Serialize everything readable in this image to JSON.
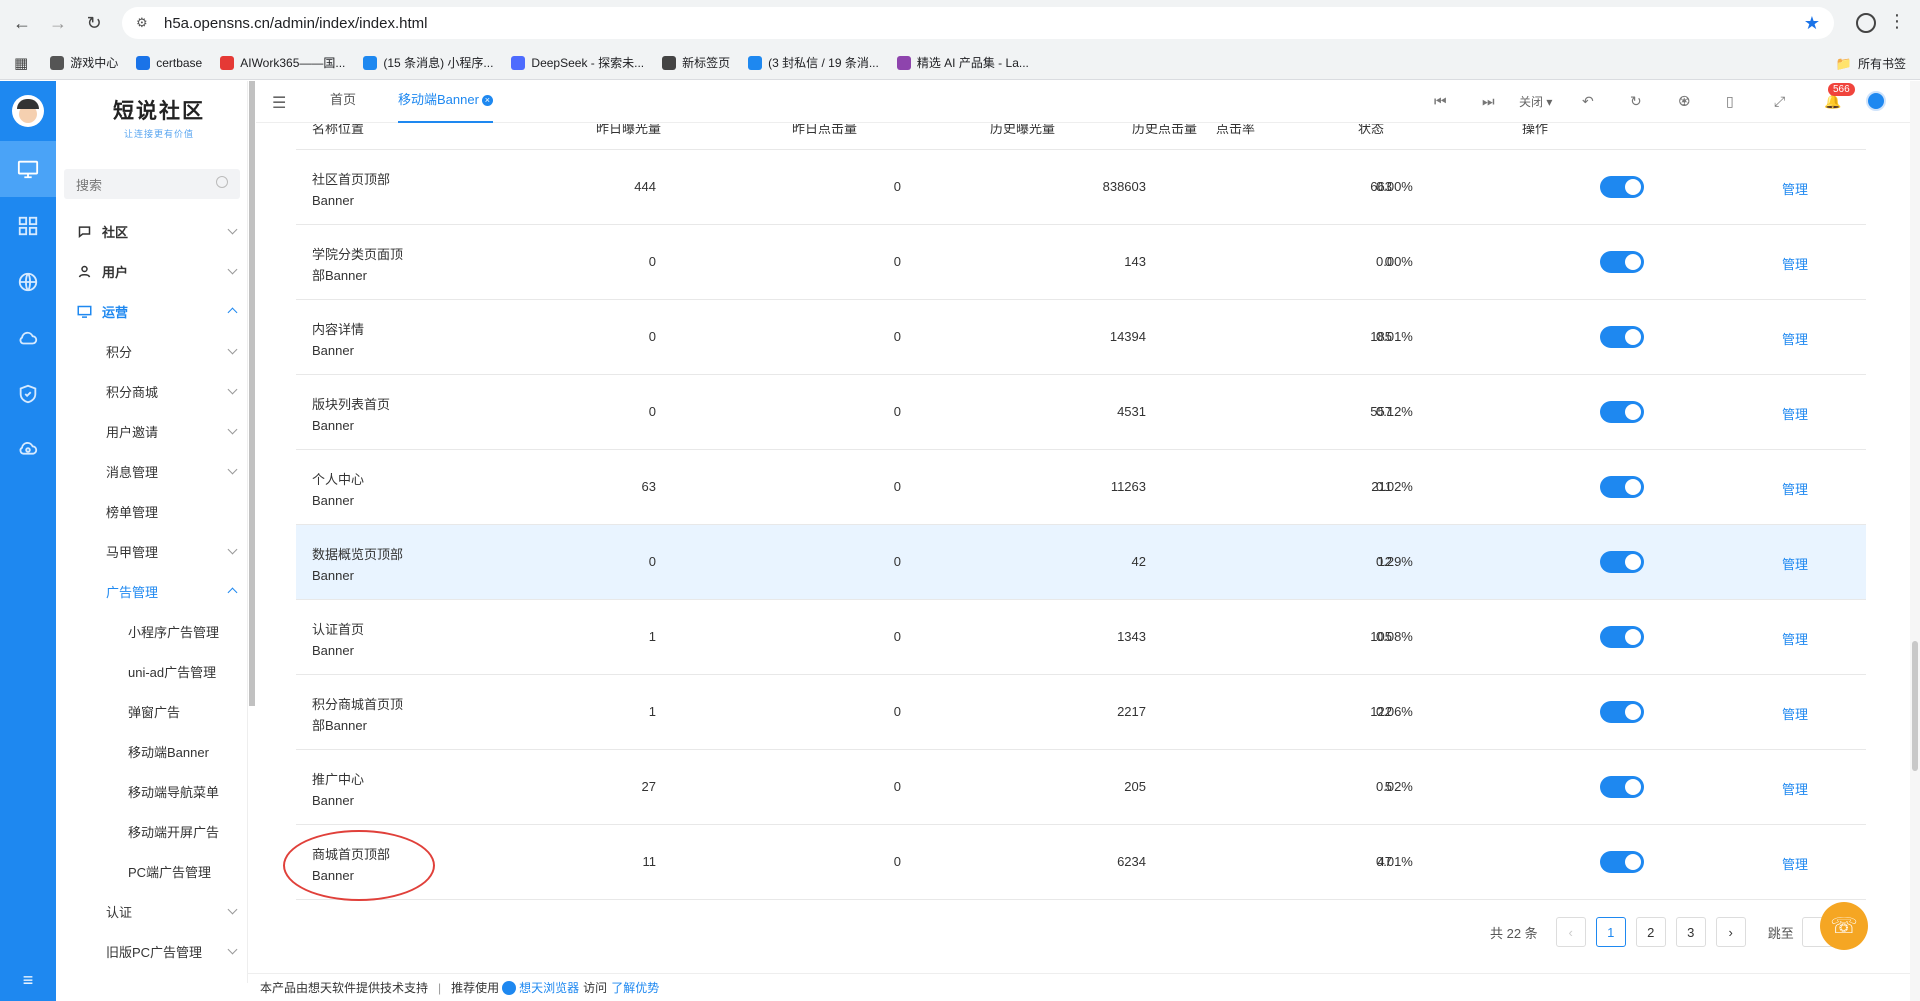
{
  "browser": {
    "url": "h5a.opensns.cn/admin/index/index.html",
    "bookmarks": [
      {
        "label": "游戏中心",
        "icon": "globe-icon",
        "color": "#555555"
      },
      {
        "label": "certbase",
        "icon": "c-icon",
        "color": "#1a73e8"
      },
      {
        "label": "AIWork365——国...",
        "icon": "aiwork-icon",
        "color": "#e53935"
      },
      {
        "label": "(15 条消息) 小程序...",
        "icon": "zhihu-icon",
        "color": "#1e88f0"
      },
      {
        "label": "DeepSeek - 探索未...",
        "icon": "deepseek-icon",
        "color": "#4d6bfe"
      },
      {
        "label": "新标签页",
        "icon": "chrome-icon",
        "color": "#444444"
      },
      {
        "label": "(3 封私信 / 19 条消...",
        "icon": "zhihu-icon",
        "color": "#1e88f0"
      },
      {
        "label": "精选 AI 产品集 - La...",
        "icon": "ai-icon",
        "color": "#8e44ad"
      }
    ],
    "all_bookmarks": "所有书签"
  },
  "sidebar": {
    "logo_main": "短说社区",
    "logo_sub": "让连接更有价值",
    "search_placeholder": "搜索",
    "menu": [
      {
        "label": "社区",
        "level": "top",
        "icon": "chat-icon"
      },
      {
        "label": "用户",
        "level": "top",
        "icon": "user-icon"
      },
      {
        "label": "运营",
        "level": "top",
        "icon": "monitor-icon",
        "active": true
      },
      {
        "label": "积分",
        "level": "sub"
      },
      {
        "label": "积分商城",
        "level": "sub"
      },
      {
        "label": "用户邀请",
        "level": "sub"
      },
      {
        "label": "消息管理",
        "level": "sub"
      },
      {
        "label": "榜单管理",
        "level": "sub"
      },
      {
        "label": "马甲管理",
        "level": "sub"
      },
      {
        "label": "广告管理",
        "level": "sub",
        "active": true
      },
      {
        "label": "小程序广告管理",
        "level": "leaf"
      },
      {
        "label": "uni-ad广告管理",
        "level": "leaf"
      },
      {
        "label": "弹窗广告",
        "level": "leaf"
      },
      {
        "label": "移动端Banner",
        "level": "leaf"
      },
      {
        "label": "移动端导航菜单",
        "level": "leaf"
      },
      {
        "label": "移动端开屏广告",
        "level": "leaf"
      },
      {
        "label": "PC端广告管理",
        "level": "leaf"
      },
      {
        "label": "认证",
        "level": "sub"
      },
      {
        "label": "旧版PC广告管理",
        "level": "sub"
      }
    ]
  },
  "tabs": {
    "home": "首页",
    "active": "移动端Banner",
    "close_label": "关闭",
    "notification_count": "566"
  },
  "table": {
    "headers": [
      "名称位置",
      "昨日曝光量",
      "昨日点击量",
      "历史曝光量",
      "历史点击量",
      "点击率",
      "状态",
      "操作"
    ],
    "rows": [
      {
        "name1": "社区首页顶部",
        "name2": "Banner",
        "y_exp": "444",
        "y_click": "0",
        "h_exp": "838603",
        "h_click": "663",
        "rate": "0.00%",
        "action": "管理"
      },
      {
        "name1": "学院分类页面顶",
        "name2": "部Banner",
        "y_exp": "0",
        "y_click": "0",
        "h_exp": "143",
        "h_click": "0",
        "rate": "0.00%",
        "action": "管理"
      },
      {
        "name1": "内容详情",
        "name2": "Banner",
        "y_exp": "0",
        "y_click": "0",
        "h_exp": "14394",
        "h_click": "185",
        "rate": "0.01%",
        "action": "管理"
      },
      {
        "name1": "版块列表首页",
        "name2": "Banner",
        "y_exp": "0",
        "y_click": "0",
        "h_exp": "4531",
        "h_click": "557",
        "rate": "0.12%",
        "action": "管理"
      },
      {
        "name1": "个人中心",
        "name2": "Banner",
        "y_exp": "63",
        "y_click": "0",
        "h_exp": "11263",
        "h_click": "211",
        "rate": "0.02%",
        "action": "管理"
      },
      {
        "name1": "数据概览页顶部",
        "name2": "Banner",
        "y_exp": "0",
        "y_click": "0",
        "h_exp": "42",
        "h_click": "12",
        "rate": "0.29%",
        "action": "管理"
      },
      {
        "name1": "认证首页",
        "name2": "Banner",
        "y_exp": "1",
        "y_click": "0",
        "h_exp": "1343",
        "h_click": "105",
        "rate": "0.08%",
        "action": "管理"
      },
      {
        "name1": "积分商城首页顶",
        "name2": "部Banner",
        "y_exp": "1",
        "y_click": "0",
        "h_exp": "2217",
        "h_click": "122",
        "rate": "0.06%",
        "action": "管理"
      },
      {
        "name1": "推广中心",
        "name2": "Banner",
        "y_exp": "27",
        "y_click": "0",
        "h_exp": "205",
        "h_click": "5",
        "rate": "0.02%",
        "action": "管理"
      },
      {
        "name1": "商城首页顶部",
        "name2": "Banner",
        "y_exp": "11",
        "y_click": "0",
        "h_exp": "6234",
        "h_click": "47",
        "rate": "0.01%",
        "action": "管理"
      }
    ]
  },
  "pagination": {
    "total": "共 22 条",
    "pages": [
      "1",
      "2",
      "3"
    ],
    "current": "1",
    "jump_label": "跳至"
  },
  "footer": {
    "support_text": "本产品由想天软件提供技术支持",
    "separator": "|",
    "recommend": "推荐使用",
    "browser_name": "想天浏览器",
    "visit": "访问",
    "learn_more": "了解优势"
  },
  "colors": {
    "primary": "#1e88f0",
    "highlight_row": "#e9f4ff",
    "badge": "#f0443c",
    "annotation_circle": "#e0403a"
  }
}
